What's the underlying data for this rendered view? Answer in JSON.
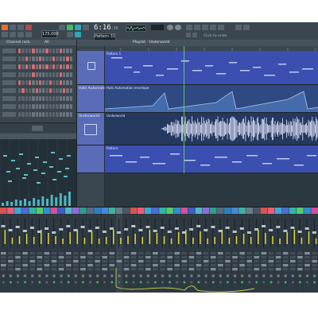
{
  "toolbar": {
    "time": "6:16",
    "time_sub": ":36",
    "tempo": "175.000",
    "pattern": "Pattern 31",
    "hint": "Click to undo"
  },
  "rack": {
    "title": "Channel rack",
    "filter": "All"
  },
  "playlist": {
    "title": "Playlist - Underworld",
    "tracks": [
      {
        "name": "",
        "clip": "Pattern 1"
      },
      {
        "name": "Hats Automation",
        "clip": "Hats Automation envelope"
      },
      {
        "name": "Underworld",
        "clip": "Underworld"
      },
      {
        "name": "",
        "clip": "Pattern"
      }
    ]
  },
  "colors": {
    "app_bg": "#2f3a43",
    "playlist_clip": "#3b4fb0",
    "automation_clip": "#3c6fa8",
    "audio_clip": "#2c3e66",
    "step_on": "#d96c6c",
    "mixer_meter": "#d8cf3a",
    "routing_wire": "#c8d84a"
  }
}
